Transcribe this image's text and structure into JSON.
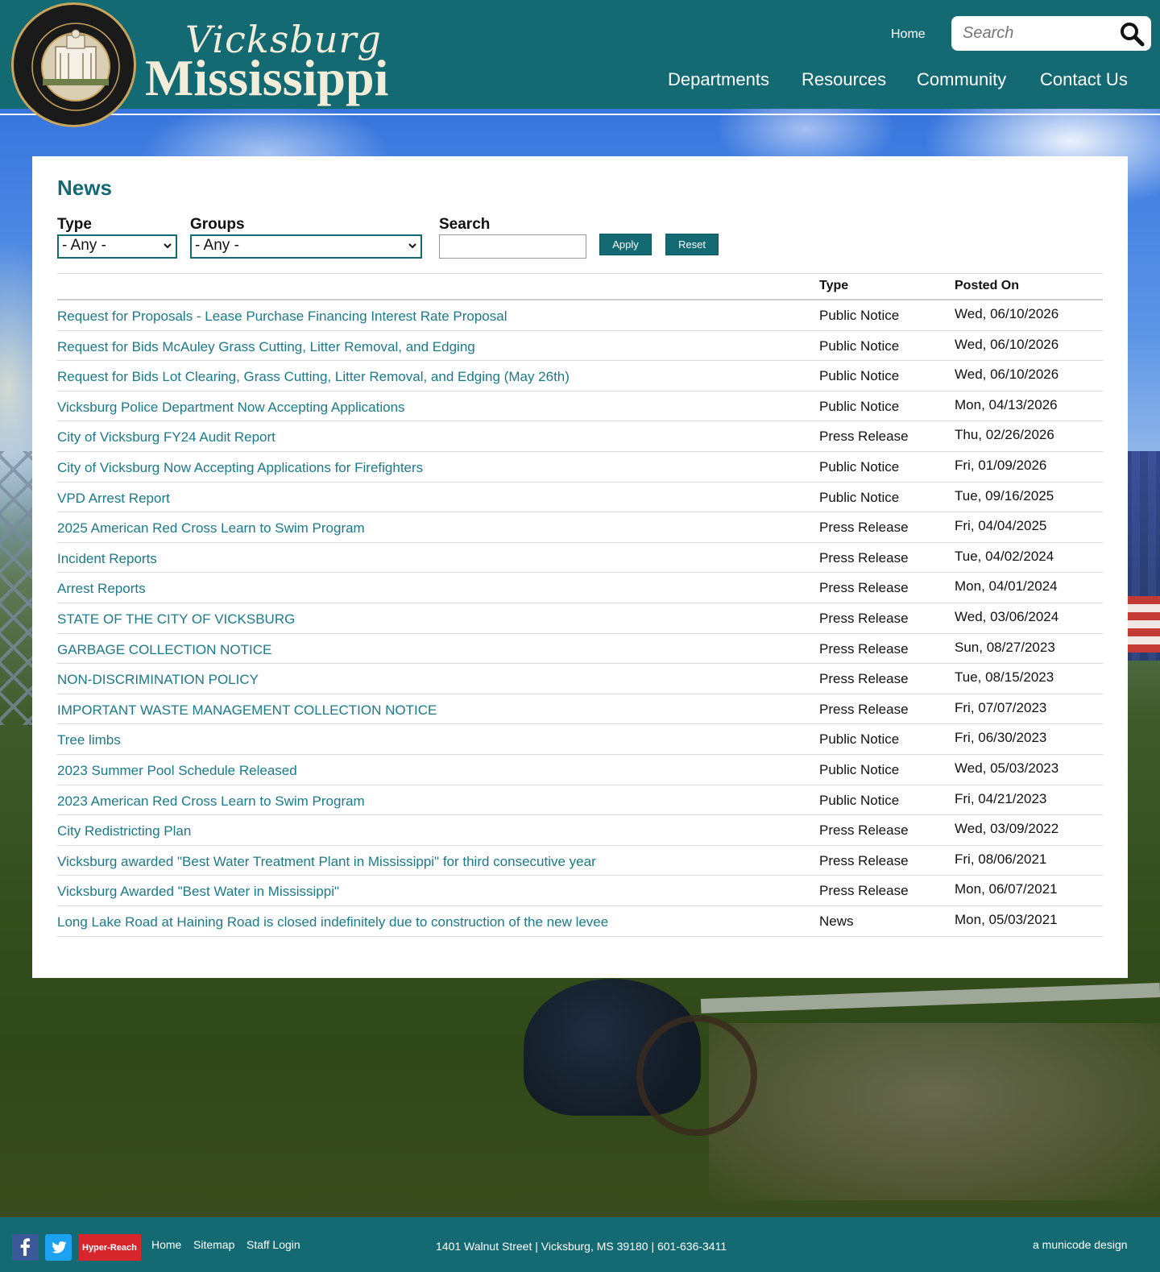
{
  "header": {
    "seal_text": "CITY OF VICKSBURG MISSISSIPPI",
    "logo_script": "Vicksburg",
    "logo_main": "Mississippi",
    "home_label": "Home",
    "search_placeholder": "Search",
    "search_icon": "search-icon",
    "nav": [
      "Departments",
      "Resources",
      "Community",
      "Contact Us"
    ],
    "brand_color": "#136a72"
  },
  "main": {
    "title": "News",
    "filters": {
      "type_label": "Type",
      "type_value": "- Any -",
      "groups_label": "Groups",
      "groups_value": "- Any -",
      "search_label": "Search",
      "search_value": "",
      "apply_label": "Apply",
      "reset_label": "Reset"
    },
    "table": {
      "columns": [
        "",
        "Type",
        "Posted On"
      ],
      "rows": [
        {
          "title": "Request for Proposals - Lease Purchase Financing Interest Rate Proposal",
          "type": "Public Notice",
          "date": "Wed, 06/10/2026"
        },
        {
          "title": "Request for Bids McAuley Grass Cutting, Litter Removal, and Edging",
          "type": "Public Notice",
          "date": "Wed, 06/10/2026"
        },
        {
          "title": "Request for Bids Lot Clearing, Grass Cutting, Litter Removal, and Edging (May 26th)",
          "type": "Public Notice",
          "date": "Wed, 06/10/2026"
        },
        {
          "title": "Vicksburg Police Department Now Accepting Applications",
          "type": "Public Notice",
          "date": "Mon, 04/13/2026"
        },
        {
          "title": "City of Vicksburg FY24 Audit Report",
          "type": "Press Release",
          "date": "Thu, 02/26/2026"
        },
        {
          "title": "City of Vicksburg Now Accepting Applications for Firefighters",
          "type": "Public Notice",
          "date": "Fri, 01/09/2026"
        },
        {
          "title": "VPD Arrest Report",
          "type": "Public Notice",
          "date": "Tue, 09/16/2025"
        },
        {
          "title": "2025 American Red Cross Learn to Swim Program",
          "type": "Press Release",
          "date": "Fri, 04/04/2025"
        },
        {
          "title": "Incident Reports",
          "type": "Press Release",
          "date": "Tue, 04/02/2024"
        },
        {
          "title": "Arrest Reports",
          "type": "Press Release",
          "date": "Mon, 04/01/2024"
        },
        {
          "title": "STATE OF THE CITY OF VICKSBURG",
          "type": "Press Release",
          "date": "Wed, 03/06/2024"
        },
        {
          "title": "GARBAGE COLLECTION NOTICE",
          "type": "Press Release",
          "date": "Sun, 08/27/2023"
        },
        {
          "title": "NON-DISCRIMINATION POLICY",
          "type": "Press Release",
          "date": "Tue, 08/15/2023"
        },
        {
          "title": "IMPORTANT WASTE MANAGEMENT COLLECTION NOTICE",
          "type": "Press Release",
          "date": "Fri, 07/07/2023"
        },
        {
          "title": "Tree limbs",
          "type": "Public Notice",
          "date": "Fri, 06/30/2023"
        },
        {
          "title": "2023 Summer Pool Schedule Released",
          "type": "Public Notice",
          "date": "Wed, 05/03/2023"
        },
        {
          "title": "2023 American Red Cross Learn to Swim Program",
          "type": "Public Notice",
          "date": "Fri, 04/21/2023"
        },
        {
          "title": "City Redistricting Plan",
          "type": "Press Release",
          "date": "Wed, 03/09/2022"
        },
        {
          "title": "Vicksburg awarded \"Best Water Treatment Plant in Mississippi\" for third consecutive year",
          "type": "Press Release",
          "date": "Fri, 08/06/2021"
        },
        {
          "title": "Vicksburg Awarded \"Best Water in Mississippi\"",
          "type": "Press Release",
          "date": "Mon, 06/07/2021"
        },
        {
          "title": "Long Lake Road at Haining Road is closed indefinitely due to construction of the new levee",
          "type": "News",
          "date": "Mon, 05/03/2021"
        }
      ]
    }
  },
  "footer": {
    "social_icons": [
      "facebook-icon",
      "twitter-icon"
    ],
    "hyper_reach_label": "Hyper-Reach",
    "links": [
      "Home",
      "Sitemap",
      "Staff Login"
    ],
    "address": "1401 Walnut Street | Vicksburg, MS 39180 | 601-636-3411",
    "credit": "a municode design"
  }
}
